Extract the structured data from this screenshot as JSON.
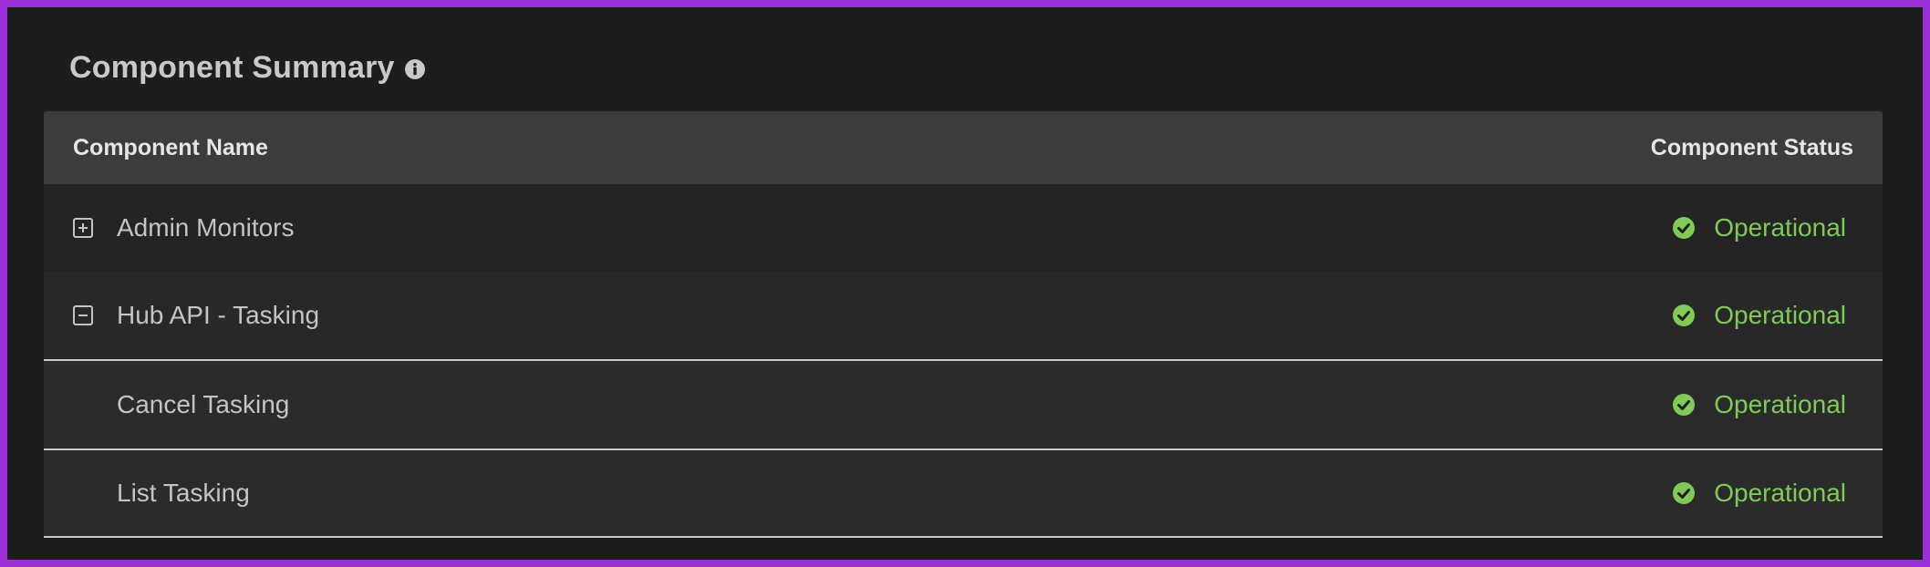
{
  "header": {
    "title": "Component Summary",
    "info_icon": "info-circle-icon"
  },
  "table": {
    "columns": [
      "Component Name",
      "Component Status"
    ],
    "rows": [
      {
        "name": "Admin Monitors",
        "status": "Operational",
        "toggle": "expand-plus-icon",
        "level": 0
      },
      {
        "name": "Hub API - Tasking",
        "status": "Operational",
        "toggle": "collapse-minus-icon",
        "level": 0
      },
      {
        "name": "Cancel Tasking",
        "status": "Operational",
        "toggle": null,
        "level": 1
      },
      {
        "name": "List Tasking",
        "status": "Operational",
        "toggle": null,
        "level": 1
      }
    ]
  },
  "colors": {
    "accent_border": "#9b30d9",
    "status_ok": "#7fcc55",
    "background": "#1d1d1d",
    "header_bg": "#3c3c3c"
  },
  "icons": {
    "status": "check-circle-icon"
  }
}
